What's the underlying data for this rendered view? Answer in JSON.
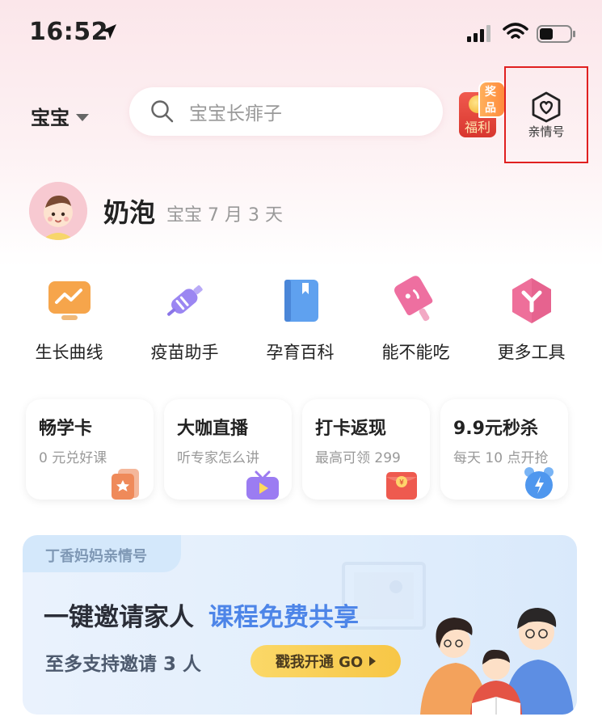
{
  "status_bar": {
    "time": "16:52",
    "icons": [
      "location-arrow-icon",
      "cellular-signal-icon",
      "wifi-icon",
      "battery-icon"
    ]
  },
  "header": {
    "baby_selector": "宝宝",
    "search_placeholder": "宝宝长痱子",
    "welfare": {
      "label": "福利",
      "badge": "奖品"
    },
    "family_account": {
      "label": "亲情号",
      "icon": "heart-house-icon"
    }
  },
  "profile": {
    "name": "奶泡",
    "age": "宝宝 7 月 3 天"
  },
  "tools": [
    {
      "label": "生长曲线",
      "icon": "growth-chart-icon"
    },
    {
      "label": "疫苗助手",
      "icon": "vaccine-syringe-icon"
    },
    {
      "label": "孕育百科",
      "icon": "encyclopedia-book-icon"
    },
    {
      "label": "能不能吃",
      "icon": "popsicle-icon"
    },
    {
      "label": "更多工具",
      "icon": "more-tools-hexagon-icon"
    }
  ],
  "cards": [
    {
      "title": "畅学卡",
      "subtitle": "0 元兑好课",
      "icon": "star-card-icon"
    },
    {
      "title": "大咖直播",
      "subtitle": "听专家怎么讲",
      "icon": "live-tv-icon"
    },
    {
      "title": "打卡返现",
      "subtitle": "最高可领 299",
      "icon": "red-envelope-icon"
    },
    {
      "title": "9.9元秒杀",
      "subtitle": "每天 10 点开抢",
      "icon": "alarm-clock-icon"
    }
  ],
  "banner": {
    "tag": "丁香妈妈亲情号",
    "headline": "一键邀请家人",
    "headline_accent": "课程免费共享",
    "subline": "至多支持邀请 3 人",
    "cta": "戳我开通 GO",
    "illustration": "family-reading-illustration"
  },
  "colors": {
    "accent_blue": "#4d85e8",
    "highlight_red": "#e02020",
    "cta_yellow": "#f7c646",
    "welfare_red": "#d8362f"
  }
}
